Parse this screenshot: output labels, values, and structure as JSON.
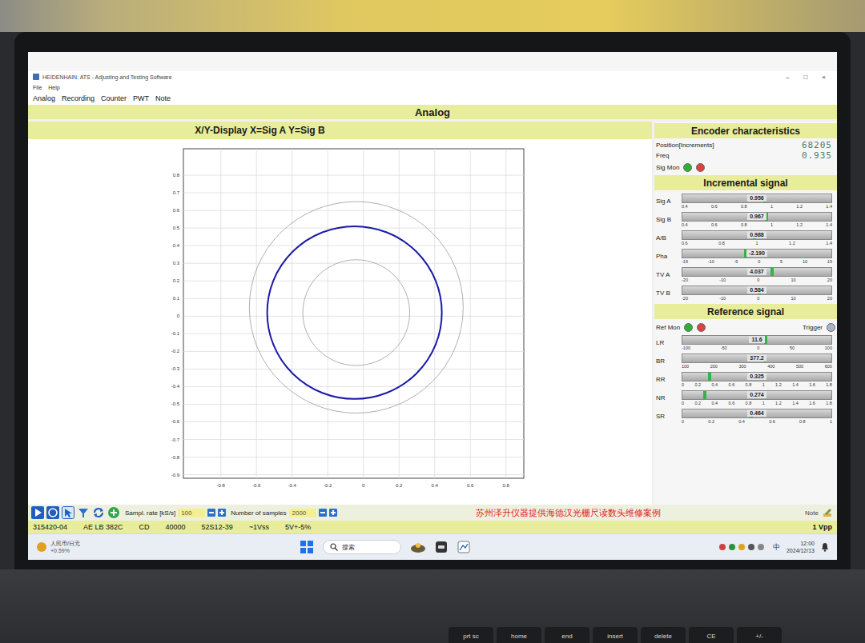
{
  "window": {
    "title": "HEIDENHAIN: ATS - Adjusting and Testing Software",
    "controls": [
      "–",
      "□",
      "×"
    ]
  },
  "menu": [
    "File",
    "Help"
  ],
  "nav": [
    "Analog",
    "Recording",
    "Counter",
    "PWT",
    "Note"
  ],
  "page_title": "Analog",
  "chart": {
    "title": "X/Y-Display X=Sig A Y=Sig B",
    "x_ticks": [
      "-0.8",
      "-0.6",
      "-0.4",
      "-0.2",
      "0",
      "0.2",
      "0.4",
      "0.6",
      "0.8"
    ],
    "y_ticks": [
      "0.8",
      "0.7",
      "0.6",
      "0.5",
      "0.4",
      "0.3",
      "0.2",
      "0.1",
      "0",
      "-0.1",
      "-0.2",
      "-0.3",
      "-0.4",
      "-0.5",
      "-0.6",
      "-0.7",
      "-0.8",
      "-0.9"
    ],
    "x_range": [
      -1.01,
      0.9
    ],
    "y_range": [
      -0.92,
      0.95
    ],
    "rings": [
      {
        "name": "outer-limit",
        "cx": -0.04,
        "cy": 0.05,
        "r": 0.6,
        "color": "#9a9a9a"
      },
      {
        "name": "signal",
        "cx": -0.05,
        "cy": 0.02,
        "r": 0.49,
        "color": "#1a1aa8"
      },
      {
        "name": "inner-limit",
        "cx": -0.04,
        "cy": 0.02,
        "r": 0.3,
        "color": "#9a9a9a"
      }
    ]
  },
  "encoder": {
    "title": "Encoder characteristics",
    "position_label": "Position[Increments]",
    "position": "68205",
    "freq_label": "Freq",
    "freq": "0.935",
    "monitor": {
      "label": "Sig Mon",
      "lights": [
        {
          "color": "#2fae3a"
        },
        {
          "color": "#e04040"
        }
      ]
    }
  },
  "incremental": {
    "title": "Incremental signal",
    "bars": [
      {
        "label": "Sig A",
        "reading": "0.956",
        "level": 0.556,
        "scale": [
          "0.4",
          "0.6",
          "0.8",
          "1",
          "1.2",
          "1.4"
        ]
      },
      {
        "label": "Sig B",
        "reading": "0.967",
        "level": 0.567,
        "scale": [
          "0.4",
          "0.6",
          "0.8",
          "1",
          "1.2",
          "1.4"
        ]
      },
      {
        "label": "A/B",
        "reading": "0.988",
        "level": 0.485,
        "scale": [
          "0.6",
          "0.8",
          "1",
          "1.2",
          "1.4"
        ]
      },
      {
        "label": "Pha",
        "reading": "-2.190",
        "level": 0.427,
        "scale": [
          "-15",
          "-10",
          "-5",
          "0",
          "5",
          "10",
          "15"
        ]
      },
      {
        "label": "TV A",
        "reading": "4.037",
        "level": 0.601,
        "scale": [
          "-20",
          "-10",
          "0",
          "10",
          "20"
        ]
      },
      {
        "label": "TV B",
        "reading": "0.584",
        "level": 0.515,
        "scale": [
          "-20",
          "-10",
          "0",
          "10",
          "20"
        ]
      }
    ]
  },
  "reference": {
    "title": "Reference signal",
    "monitor": {
      "label": "Ref Mon",
      "lights": [
        {
          "color": "#2fae3a"
        },
        {
          "color": "#e04040"
        }
      ]
    },
    "trigger": {
      "label": "Trigger",
      "color": "#a8b4c8"
    },
    "bars": [
      {
        "label": "LR",
        "reading": "11.6",
        "level": 0.558,
        "scale": [
          "-100",
          "-50",
          "0",
          "50",
          "100"
        ]
      },
      {
        "label": "BR",
        "reading": "377.2",
        "level": 0.554,
        "scale": [
          "100",
          "200",
          "300",
          "400",
          "500",
          "600"
        ]
      },
      {
        "label": "RR",
        "reading": "0.325",
        "level": 0.181,
        "scale": [
          "0",
          "0.2",
          "0.4",
          "0.6",
          "0.8",
          "1",
          "1.2",
          "1.4",
          "1.6",
          "1.8"
        ]
      },
      {
        "label": "NR",
        "reading": "0.274",
        "level": 0.152,
        "scale": [
          "0",
          "0.2",
          "0.4",
          "0.6",
          "0.8",
          "1",
          "1.2",
          "1.4",
          "1.6",
          "1.8"
        ]
      },
      {
        "label": "SR",
        "reading": "0.464",
        "level": 0.464,
        "scale": [
          "0",
          "0.2",
          "0.4",
          "0.6",
          "0.8",
          "1"
        ]
      }
    ]
  },
  "toolbar": {
    "sample_rate_label": "Sampl. rate [kS/s]",
    "sample_rate": "100",
    "samples_label": "Number of samples",
    "samples": "2000",
    "caption": "苏州泽升仪器提供海德汉光栅尺读数头维修案例",
    "note": "Note"
  },
  "status_bar": {
    "items": [
      "315420-04",
      "AE LB 382C",
      "CD",
      "40000",
      "52S12-39",
      "~1Vss",
      "5V+-5%"
    ],
    "signal": "1 Vpp"
  },
  "taskbar": {
    "widget": "人民币/日元",
    "widget_change": "+0.59%",
    "search": "搜索",
    "ime": "中",
    "time": "12:00",
    "date": "2024/12/13"
  },
  "keyboard": {
    "keys": [
      "prt sc",
      "home",
      "end",
      "insert",
      "delete",
      "CE",
      "+/-"
    ]
  }
}
